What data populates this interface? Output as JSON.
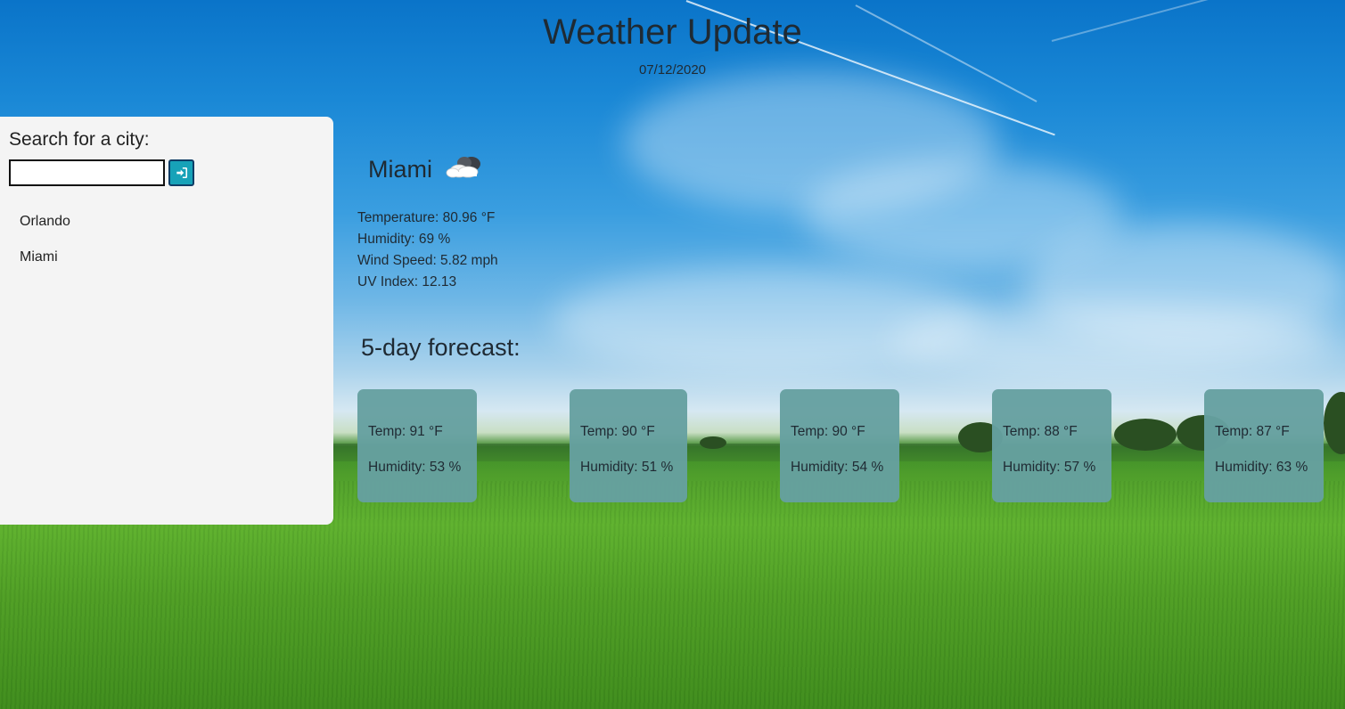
{
  "header": {
    "title": "Weather Update",
    "date": "07/12/2020"
  },
  "sidebar": {
    "search_title": "Search for a city:",
    "search_value": "",
    "search_placeholder": "",
    "search_button_icon": "sign-in-icon",
    "history": [
      "Orlando",
      "Miami"
    ]
  },
  "current": {
    "city": "Miami",
    "icon": "partly-cloudy-icon",
    "temperature": "Temperature: 80.96 °F",
    "humidity": "Humidity: 69 %",
    "wind": "Wind Speed: 5.82 mph",
    "uv": "UV Index: 12.13"
  },
  "forecast": {
    "title": "5-day forecast:",
    "days": [
      {
        "temp": "Temp: 91 °F",
        "humidity": "Humidity: 53 %"
      },
      {
        "temp": "Temp: 90 °F",
        "humidity": "Humidity: 51 %"
      },
      {
        "temp": "Temp: 90 °F",
        "humidity": "Humidity: 54 %"
      },
      {
        "temp": "Temp: 88 °F",
        "humidity": "Humidity: 57 %"
      },
      {
        "temp": "Temp: 87 °F",
        "humidity": "Humidity: 63 %"
      }
    ]
  },
  "colors": {
    "card_bg": "#66a0a0",
    "button_bg": "#17a2b8",
    "sidebar_bg": "#f4f4f4"
  }
}
